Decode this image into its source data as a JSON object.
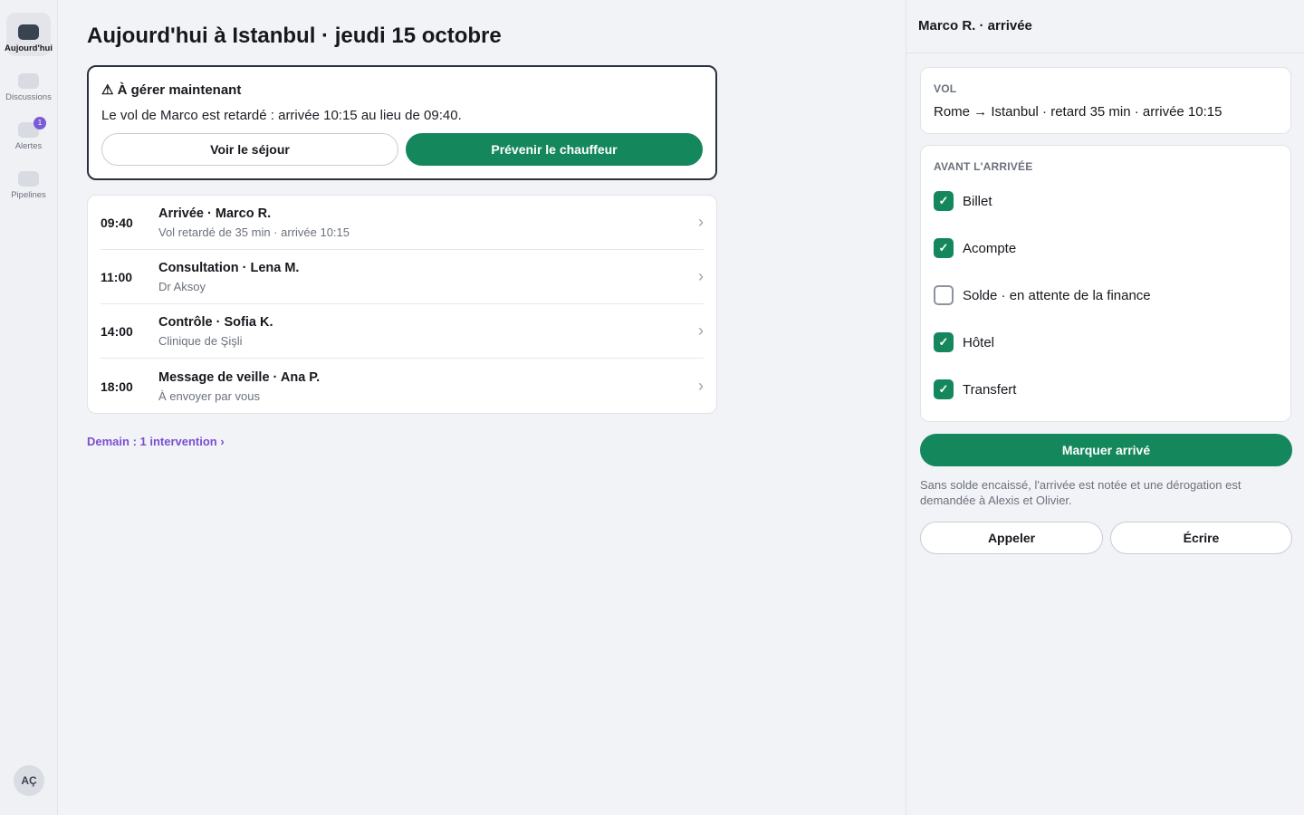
{
  "sidebar": {
    "items": [
      {
        "label": "Aujourd'hui",
        "active": true
      },
      {
        "label": "Discussions",
        "active": false
      },
      {
        "label": "Alertes",
        "active": false,
        "badge": "1"
      },
      {
        "label": "Pipelines",
        "active": false
      }
    ],
    "avatar_initials": "AÇ"
  },
  "main": {
    "title": "Aujourd'hui à Istanbul · jeudi 15 octobre",
    "alert": {
      "icon": "⚠",
      "title": "À gérer maintenant",
      "text": "Le vol de Marco est retardé : arrivée 10:15 au lieu de 09:40.",
      "secondary_button": "Voir le séjour",
      "primary_button": "Prévenir le chauffeur"
    },
    "schedule": [
      {
        "time": "09:40",
        "title": "Arrivée · Marco R.",
        "subtitle": "Vol retardé de 35 min · arrivée 10:15"
      },
      {
        "time": "11:00",
        "title": "Consultation · Lena M.",
        "subtitle": "Dr Aksoy"
      },
      {
        "time": "14:00",
        "title": "Contrôle · Sofia K.",
        "subtitle": "Clinique de Şişli"
      },
      {
        "time": "18:00",
        "title": "Message de veille · Ana P.",
        "subtitle": "À envoyer par vous"
      }
    ],
    "tomorrow_link": "Demain : 1 intervention ›"
  },
  "panel": {
    "title": "Marco R. · arrivée",
    "flight": {
      "label": "VOL",
      "text": "Rome → Istanbul · retard 35 min · arrivée 10:15"
    },
    "checklist": {
      "label": "AVANT L'ARRIVÉE",
      "items": [
        {
          "label": "Billet",
          "checked": true
        },
        {
          "label": "Acompte",
          "checked": true
        },
        {
          "label": "Solde · en attente de la finance",
          "checked": false
        },
        {
          "label": "Hôtel",
          "checked": true
        },
        {
          "label": "Transfert",
          "checked": true
        }
      ]
    },
    "primary_button": "Marquer arrivé",
    "note": "Sans solde encaissé, l'arrivée est notée et une dérogation est demandée à Alexis et Olivier.",
    "call_button": "Appeler",
    "write_button": "Écrire"
  },
  "colors": {
    "accent_green": "#14875d",
    "link_purple": "#7a4fd0",
    "badge_purple": "#7a5bd6"
  },
  "icons": {
    "checkmark": "✓",
    "chevron": "›"
  }
}
